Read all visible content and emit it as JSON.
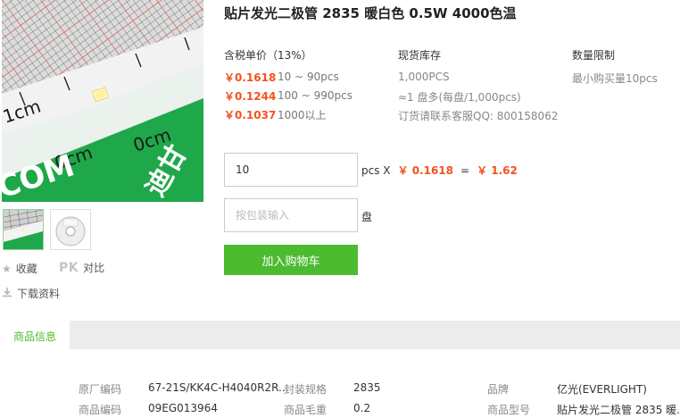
{
  "title": "贴片发光二极管 2835 暖白色 0.5W 4000色温",
  "colors": {
    "accent_green": "#4cbb2f",
    "price_red": "#f4511e"
  },
  "image": {
    "ruler_labels": [
      "1cm",
      "0cm",
      "0cm"
    ],
    "board_text": "COM",
    "board_text2": "迪甘"
  },
  "thumbnails": [
    {
      "name": "thumb-board"
    },
    {
      "name": "thumb-reel"
    }
  ],
  "side_links": {
    "favorite": "收藏",
    "compare_icon": "PK",
    "compare": "对比",
    "download": "下载资料"
  },
  "pricing": {
    "header": "含税单价（13%）",
    "tiers": [
      {
        "price": "￥0.1618",
        "qty": "10 ~ 90pcs"
      },
      {
        "price": "￥0.1244",
        "qty": "100 ~ 990pcs"
      },
      {
        "price": "￥0.1037",
        "qty": "1000以上"
      }
    ]
  },
  "stock": {
    "header": "现货库存",
    "lines": [
      "1,000PCS",
      "≈1 盘多(每盘/1,000pcs)",
      "订货请联系客服QQ: 800158062"
    ]
  },
  "limit": {
    "header": "数量限制",
    "text": "最小购买量10pcs"
  },
  "order": {
    "qty_value": "10",
    "unit_pcs": "pcs X",
    "unit_price": "￥ 0.1618",
    "equals": "=",
    "total": "￥ 1.62",
    "reel_placeholder": "按包装输入",
    "unit_reel": "盘",
    "cart_button": "加入购物车"
  },
  "tabs": {
    "active": "商品信息"
  },
  "specs": [
    {
      "label": "原厂编码",
      "value": "67-21S/KK4C-H4040R2R..."
    },
    {
      "label": "封装规格",
      "value": "2835"
    },
    {
      "label": "品牌",
      "value": "亿光(EVERLIGHT)"
    },
    {
      "label": "商品编码",
      "value": "09EG013964"
    },
    {
      "label": "商品毛重",
      "value": "0.2"
    },
    {
      "label": "商品型号",
      "value": "贴片发光二极管 2835 暖..."
    }
  ]
}
